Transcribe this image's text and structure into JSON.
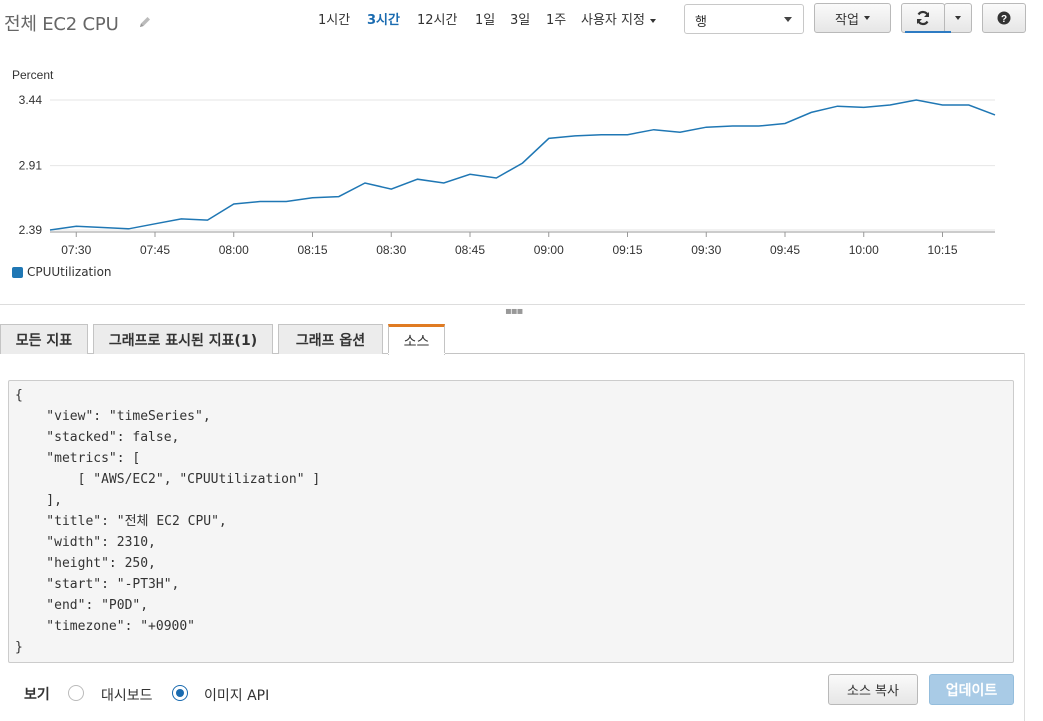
{
  "header": {
    "title": "전체 EC2 CPU",
    "ranges": [
      {
        "label": "1시간",
        "active": false
      },
      {
        "label": "3시간",
        "active": true
      },
      {
        "label": "12시간",
        "active": false
      },
      {
        "label": "1일",
        "active": false
      },
      {
        "label": "3일",
        "active": false
      },
      {
        "label": "1주",
        "active": false
      }
    ],
    "custom_label": "사용자 지정",
    "layout_select_value": "행",
    "actions_label": "작업",
    "refresh_icon": "refresh-icon",
    "help_icon": "question-icon"
  },
  "chart_data": {
    "type": "line",
    "ylabel": "Percent",
    "yticks": [
      "3.44",
      "2.91",
      "2.39"
    ],
    "ylim": [
      2.39,
      3.44
    ],
    "xticks": [
      "07:30",
      "07:45",
      "08:00",
      "08:15",
      "08:30",
      "08:45",
      "09:00",
      "09:15",
      "09:30",
      "09:45",
      "10:00",
      "10:15"
    ],
    "x": [
      "07:25",
      "07:30",
      "07:35",
      "07:40",
      "07:45",
      "07:50",
      "07:55",
      "08:00",
      "08:05",
      "08:10",
      "08:15",
      "08:20",
      "08:25",
      "08:30",
      "08:35",
      "08:40",
      "08:45",
      "08:50",
      "08:55",
      "09:00",
      "09:05",
      "09:10",
      "09:15",
      "09:20",
      "09:25",
      "09:30",
      "09:35",
      "09:40",
      "09:45",
      "09:50",
      "09:55",
      "10:00",
      "10:05",
      "10:10",
      "10:15",
      "10:20",
      "10:25"
    ],
    "series": [
      {
        "name": "CPUUtilization",
        "color": "#1f77b4",
        "values": [
          2.39,
          2.42,
          2.41,
          2.4,
          2.44,
          2.48,
          2.47,
          2.6,
          2.62,
          2.62,
          2.65,
          2.66,
          2.77,
          2.72,
          2.8,
          2.77,
          2.84,
          2.81,
          2.93,
          3.13,
          3.15,
          3.16,
          3.16,
          3.2,
          3.18,
          3.22,
          3.23,
          3.23,
          3.25,
          3.34,
          3.39,
          3.38,
          3.4,
          3.44,
          3.4,
          3.4,
          3.32
        ]
      }
    ],
    "grid": true,
    "legend": "bottom-left"
  },
  "tabs": [
    {
      "label": "모든 지표",
      "active": false
    },
    {
      "label": "그래프로 표시된 지표(1)",
      "active": false
    },
    {
      "label": "그래프 옵션",
      "active": false
    },
    {
      "label": "소스",
      "active": true
    }
  ],
  "source": {
    "lines": [
      "{",
      "    \"view\": \"timeSeries\",",
      "    \"stacked\": false,",
      "    \"metrics\": [",
      "        [ \"AWS/EC2\", \"CPUUtilization\" ]",
      "    ],",
      "    \"title\": \"전체 EC2 CPU\",",
      "    \"width\": 2310,",
      "    \"height\": 250,",
      "    \"start\": \"-PT3H\",",
      "    \"end\": \"P0D\",",
      "    \"timezone\": \"+0900\"",
      "}"
    ]
  },
  "footer": {
    "view_label": "보기",
    "options": [
      {
        "label": "대시보드",
        "checked": false
      },
      {
        "label": "이미지 API",
        "checked": true
      }
    ],
    "copy_label": "소스 복사",
    "update_label": "업데이트"
  }
}
